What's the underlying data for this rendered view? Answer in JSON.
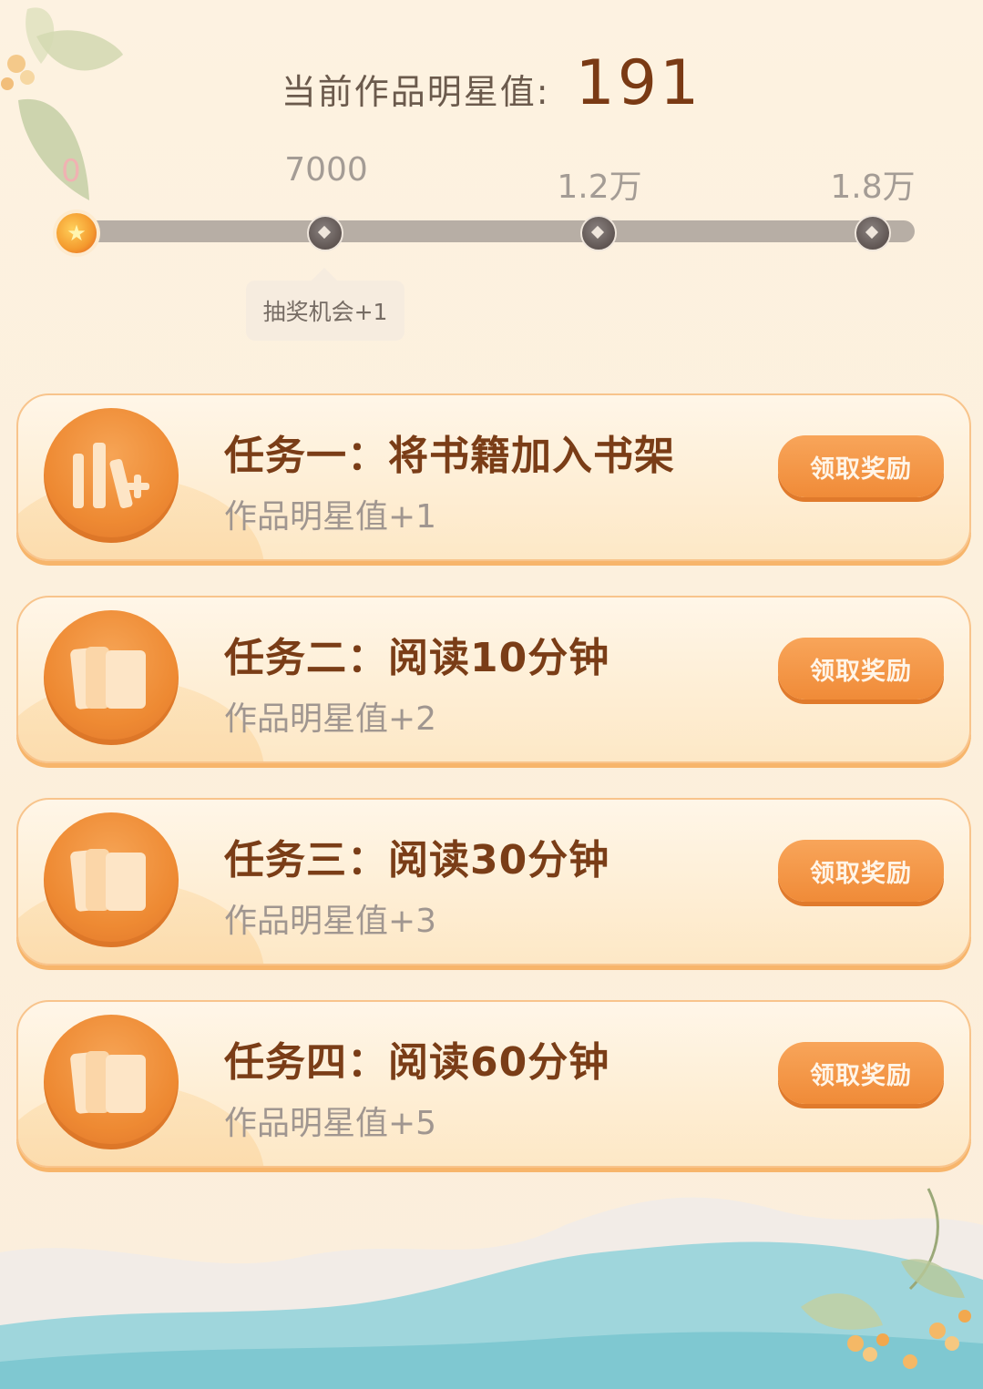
{
  "header": {
    "score_label": "当前作品明星值:",
    "score_value": "191"
  },
  "progress": {
    "current_value": 191,
    "milestones": [
      {
        "label": "0"
      },
      {
        "label": "7000"
      },
      {
        "label": "1.2万"
      },
      {
        "label": "1.8万"
      }
    ],
    "tooltip": "抽奖机会+1"
  },
  "tasks": [
    {
      "title": "任务一：将书籍加入书架",
      "reward": "作品明星值+1",
      "button": "领取奖励",
      "icon": "bookshelf-add-icon"
    },
    {
      "title": "任务二：阅读10分钟",
      "reward": "作品明星值+2",
      "button": "领取奖励",
      "icon": "book-icon"
    },
    {
      "title": "任务三：阅读30分钟",
      "reward": "作品明星值+3",
      "button": "领取奖励",
      "icon": "book-icon"
    },
    {
      "title": "任务四：阅读60分钟",
      "reward": "作品明星值+5",
      "button": "领取奖励",
      "icon": "book-icon"
    }
  ],
  "colors": {
    "accent": "#f08b38",
    "title": "#7a3d17",
    "background": "#fdf0dc",
    "track": "#b7aea5"
  }
}
